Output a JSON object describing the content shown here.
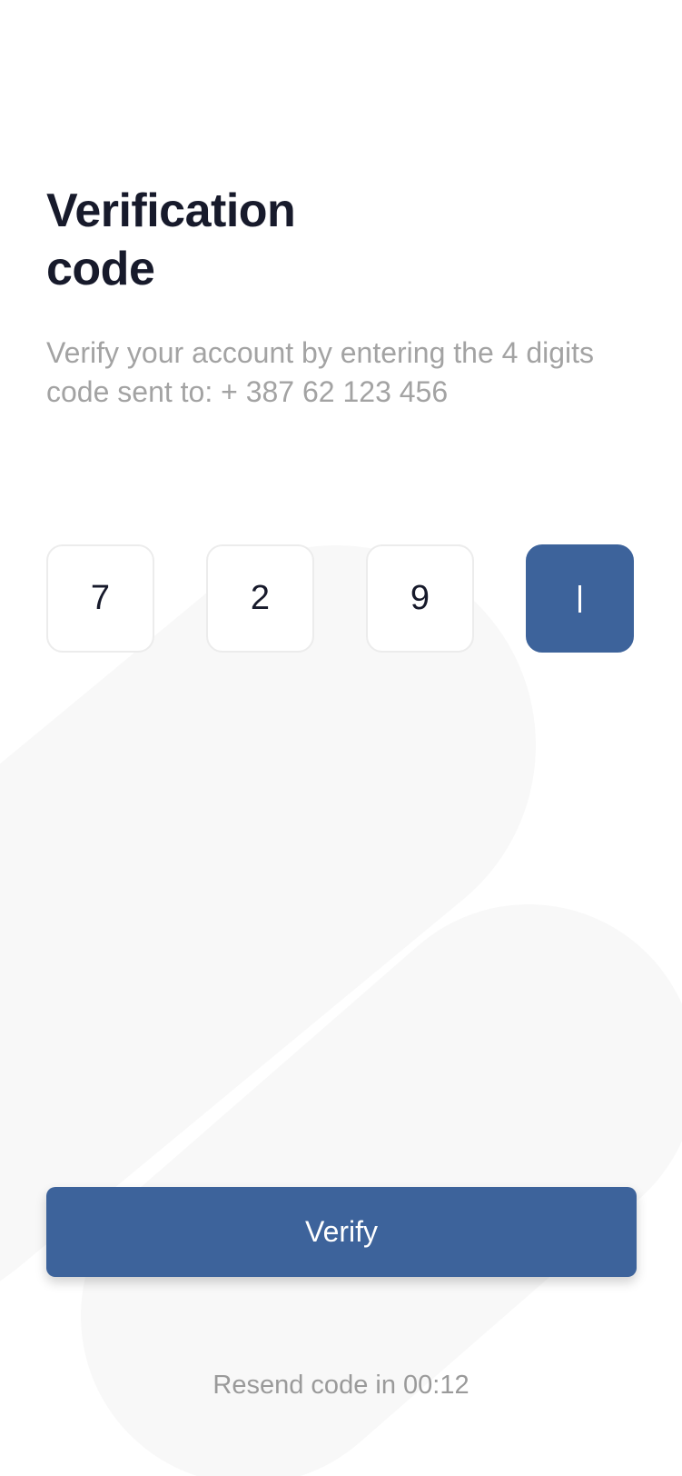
{
  "header": {
    "title": "Verification code",
    "subtitle": "Verify your account by entering the 4 digits code sent to: + 387 62 123 456"
  },
  "code": {
    "digits": [
      "7",
      "2",
      "9",
      ""
    ],
    "active_index": 3
  },
  "actions": {
    "verify_label": "Verify",
    "resend_text": "Resend code in 00:12"
  },
  "colors": {
    "accent": "#3d639b",
    "title": "#171a2b",
    "muted_text": "#a3a3a3",
    "box_border": "#ececec",
    "background_shape": "#f8f8f8"
  }
}
